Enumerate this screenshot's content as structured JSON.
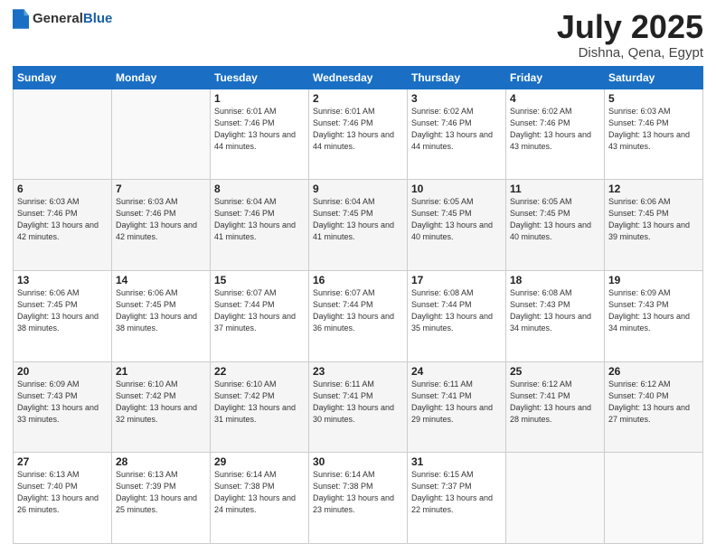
{
  "header": {
    "logo_general": "General",
    "logo_blue": "Blue",
    "month": "July 2025",
    "location": "Dishna, Qena, Egypt"
  },
  "weekdays": [
    "Sunday",
    "Monday",
    "Tuesday",
    "Wednesday",
    "Thursday",
    "Friday",
    "Saturday"
  ],
  "weeks": [
    [
      {
        "day": "",
        "info": ""
      },
      {
        "day": "",
        "info": ""
      },
      {
        "day": "1",
        "info": "Sunrise: 6:01 AM\nSunset: 7:46 PM\nDaylight: 13 hours and 44 minutes."
      },
      {
        "day": "2",
        "info": "Sunrise: 6:01 AM\nSunset: 7:46 PM\nDaylight: 13 hours and 44 minutes."
      },
      {
        "day": "3",
        "info": "Sunrise: 6:02 AM\nSunset: 7:46 PM\nDaylight: 13 hours and 44 minutes."
      },
      {
        "day": "4",
        "info": "Sunrise: 6:02 AM\nSunset: 7:46 PM\nDaylight: 13 hours and 43 minutes."
      },
      {
        "day": "5",
        "info": "Sunrise: 6:03 AM\nSunset: 7:46 PM\nDaylight: 13 hours and 43 minutes."
      }
    ],
    [
      {
        "day": "6",
        "info": "Sunrise: 6:03 AM\nSunset: 7:46 PM\nDaylight: 13 hours and 42 minutes."
      },
      {
        "day": "7",
        "info": "Sunrise: 6:03 AM\nSunset: 7:46 PM\nDaylight: 13 hours and 42 minutes."
      },
      {
        "day": "8",
        "info": "Sunrise: 6:04 AM\nSunset: 7:46 PM\nDaylight: 13 hours and 41 minutes."
      },
      {
        "day": "9",
        "info": "Sunrise: 6:04 AM\nSunset: 7:45 PM\nDaylight: 13 hours and 41 minutes."
      },
      {
        "day": "10",
        "info": "Sunrise: 6:05 AM\nSunset: 7:45 PM\nDaylight: 13 hours and 40 minutes."
      },
      {
        "day": "11",
        "info": "Sunrise: 6:05 AM\nSunset: 7:45 PM\nDaylight: 13 hours and 40 minutes."
      },
      {
        "day": "12",
        "info": "Sunrise: 6:06 AM\nSunset: 7:45 PM\nDaylight: 13 hours and 39 minutes."
      }
    ],
    [
      {
        "day": "13",
        "info": "Sunrise: 6:06 AM\nSunset: 7:45 PM\nDaylight: 13 hours and 38 minutes."
      },
      {
        "day": "14",
        "info": "Sunrise: 6:06 AM\nSunset: 7:45 PM\nDaylight: 13 hours and 38 minutes."
      },
      {
        "day": "15",
        "info": "Sunrise: 6:07 AM\nSunset: 7:44 PM\nDaylight: 13 hours and 37 minutes."
      },
      {
        "day": "16",
        "info": "Sunrise: 6:07 AM\nSunset: 7:44 PM\nDaylight: 13 hours and 36 minutes."
      },
      {
        "day": "17",
        "info": "Sunrise: 6:08 AM\nSunset: 7:44 PM\nDaylight: 13 hours and 35 minutes."
      },
      {
        "day": "18",
        "info": "Sunrise: 6:08 AM\nSunset: 7:43 PM\nDaylight: 13 hours and 34 minutes."
      },
      {
        "day": "19",
        "info": "Sunrise: 6:09 AM\nSunset: 7:43 PM\nDaylight: 13 hours and 34 minutes."
      }
    ],
    [
      {
        "day": "20",
        "info": "Sunrise: 6:09 AM\nSunset: 7:43 PM\nDaylight: 13 hours and 33 minutes."
      },
      {
        "day": "21",
        "info": "Sunrise: 6:10 AM\nSunset: 7:42 PM\nDaylight: 13 hours and 32 minutes."
      },
      {
        "day": "22",
        "info": "Sunrise: 6:10 AM\nSunset: 7:42 PM\nDaylight: 13 hours and 31 minutes."
      },
      {
        "day": "23",
        "info": "Sunrise: 6:11 AM\nSunset: 7:41 PM\nDaylight: 13 hours and 30 minutes."
      },
      {
        "day": "24",
        "info": "Sunrise: 6:11 AM\nSunset: 7:41 PM\nDaylight: 13 hours and 29 minutes."
      },
      {
        "day": "25",
        "info": "Sunrise: 6:12 AM\nSunset: 7:41 PM\nDaylight: 13 hours and 28 minutes."
      },
      {
        "day": "26",
        "info": "Sunrise: 6:12 AM\nSunset: 7:40 PM\nDaylight: 13 hours and 27 minutes."
      }
    ],
    [
      {
        "day": "27",
        "info": "Sunrise: 6:13 AM\nSunset: 7:40 PM\nDaylight: 13 hours and 26 minutes."
      },
      {
        "day": "28",
        "info": "Sunrise: 6:13 AM\nSunset: 7:39 PM\nDaylight: 13 hours and 25 minutes."
      },
      {
        "day": "29",
        "info": "Sunrise: 6:14 AM\nSunset: 7:38 PM\nDaylight: 13 hours and 24 minutes."
      },
      {
        "day": "30",
        "info": "Sunrise: 6:14 AM\nSunset: 7:38 PM\nDaylight: 13 hours and 23 minutes."
      },
      {
        "day": "31",
        "info": "Sunrise: 6:15 AM\nSunset: 7:37 PM\nDaylight: 13 hours and 22 minutes."
      },
      {
        "day": "",
        "info": ""
      },
      {
        "day": "",
        "info": ""
      }
    ]
  ]
}
